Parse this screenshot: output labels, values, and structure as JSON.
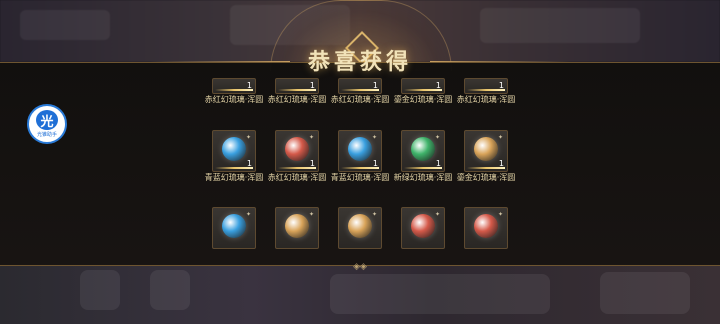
{
  "title": "恭喜获得",
  "badge": {
    "icon_text": "光",
    "caption": "光锥助手"
  },
  "colors": {
    "red": "#d55a4a",
    "blue": "#3aa0e0",
    "green": "#3fb36a",
    "gold": "#d9a45a"
  },
  "rows": [
    {
      "clipped": true,
      "items": [
        {
          "name": "赤红幻琉璃·浑圆",
          "color": "red",
          "count": "1"
        },
        {
          "name": "赤红幻琉璃·浑圆",
          "color": "red",
          "count": "1"
        },
        {
          "name": "赤红幻琉璃·浑圆",
          "color": "red",
          "count": "1"
        },
        {
          "name": "鎏金幻琉璃·浑圆",
          "color": "gold",
          "count": "1"
        },
        {
          "name": "赤红幻琉璃·浑圆",
          "color": "red",
          "count": "1"
        }
      ]
    },
    {
      "clipped": false,
      "items": [
        {
          "name": "青蓝幻琉璃·浑圆",
          "color": "blue",
          "count": "1"
        },
        {
          "name": "赤红幻琉璃·浑圆",
          "color": "red",
          "count": "1"
        },
        {
          "name": "青蓝幻琉璃·浑圆",
          "color": "blue",
          "count": "1"
        },
        {
          "name": "新绿幻琉璃·浑圆",
          "color": "green",
          "count": "1"
        },
        {
          "name": "鎏金幻琉璃·浑圆",
          "color": "gold",
          "count": "1"
        }
      ]
    },
    {
      "clipped": false,
      "items": [
        {
          "name": "",
          "color": "blue",
          "count": ""
        },
        {
          "name": "",
          "color": "gold",
          "count": ""
        },
        {
          "name": "",
          "color": "gold",
          "count": ""
        },
        {
          "name": "",
          "color": "red",
          "count": ""
        },
        {
          "name": "",
          "color": "red",
          "count": ""
        }
      ]
    }
  ]
}
